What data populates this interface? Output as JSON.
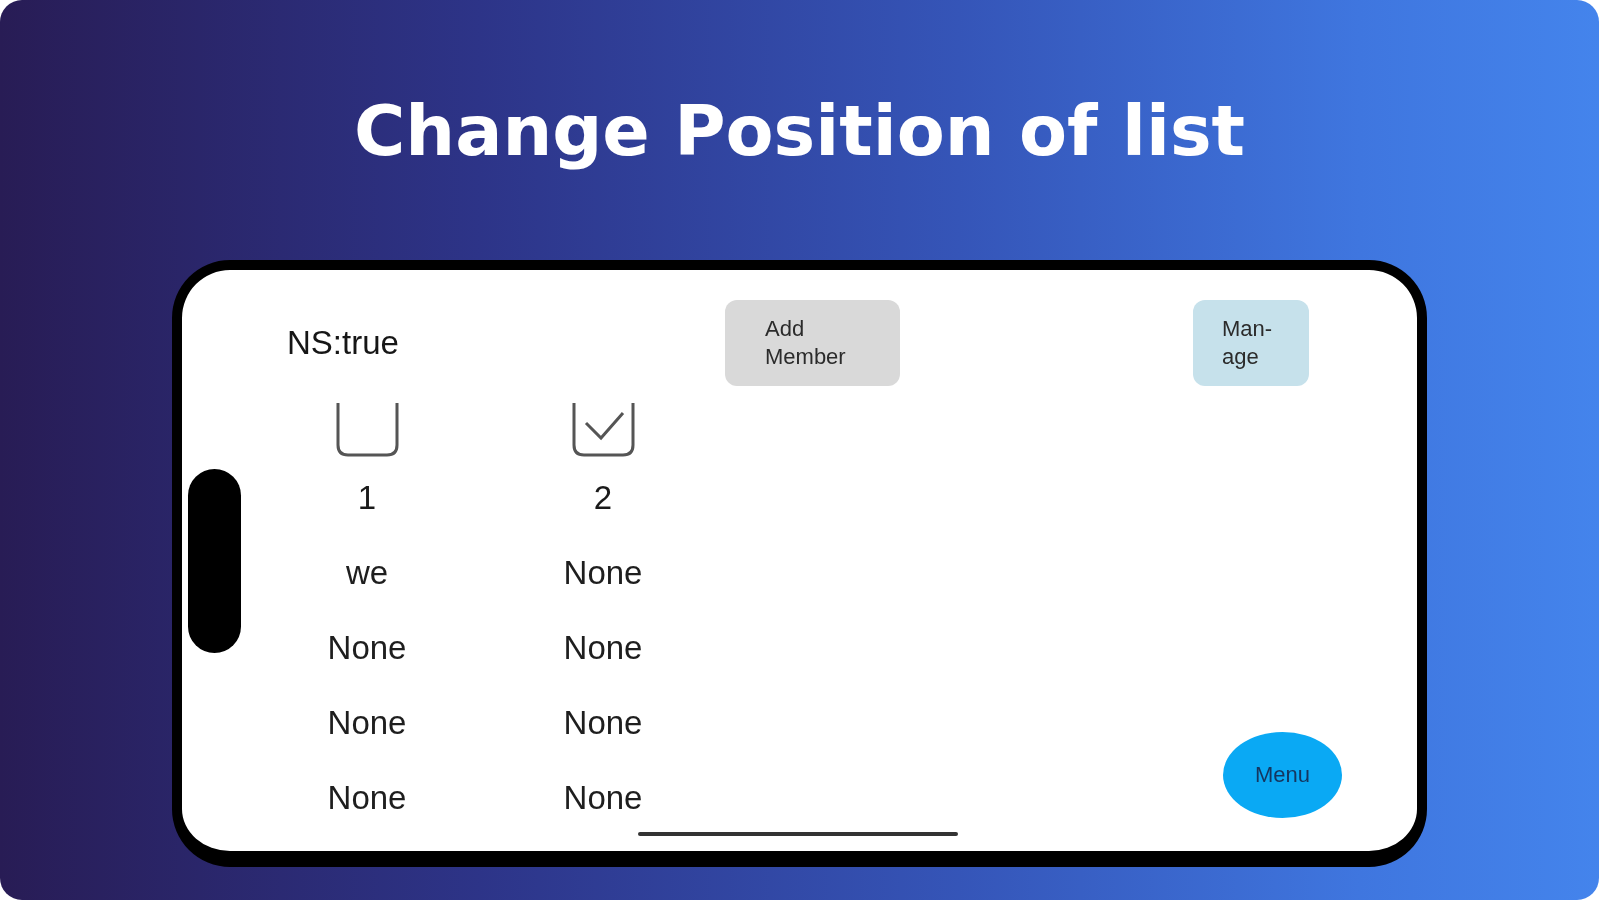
{
  "title": "Change Position of list",
  "phone": {
    "status": "NS:true",
    "add_button": {
      "label": "Add Member"
    },
    "manage_button": {
      "label": "Man-age"
    },
    "columns": [
      {
        "checked": false,
        "number": "1",
        "entries": [
          "we",
          "None",
          "None",
          "None"
        ]
      },
      {
        "checked": true,
        "number": "2",
        "entries": [
          "None",
          "None",
          "None",
          "None"
        ]
      }
    ],
    "menu_button": {
      "label": "Menu"
    }
  }
}
